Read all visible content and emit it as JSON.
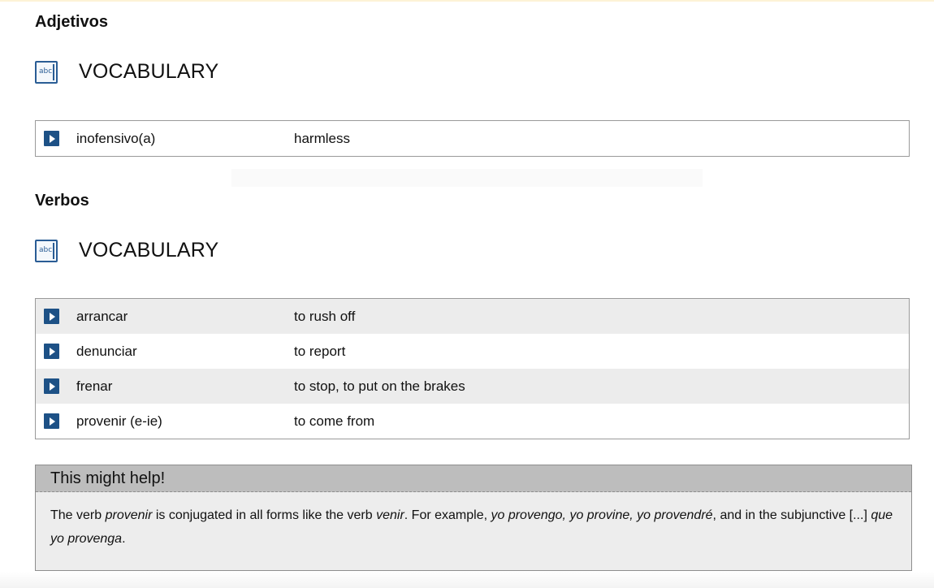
{
  "sections": [
    {
      "heading": "Adjetivos",
      "vocab_label": "VOCABULARY",
      "icon_text": "abc",
      "rows": [
        {
          "term": "inofensivo(a)",
          "meaning": "harmless"
        }
      ]
    },
    {
      "heading": "Verbos",
      "vocab_label": "VOCABULARY",
      "icon_text": "abc",
      "rows": [
        {
          "term": "arrancar",
          "meaning": "to rush off"
        },
        {
          "term": "denunciar",
          "meaning": "to report"
        },
        {
          "term": "frenar",
          "meaning": "to stop, to put on the brakes"
        },
        {
          "term": "provenir (e-ie)",
          "meaning": "to come from"
        }
      ]
    }
  ],
  "help": {
    "title": "This might help!",
    "t1": "The verb ",
    "i1": "provenir",
    "t2": " is conjugated in all forms like the verb ",
    "i2": "venir",
    "t3": ". For example, ",
    "i3": "yo provengo, yo provine, yo provendré",
    "t4": ", and in the subjunctive [...] ",
    "i4": "que yo provenga",
    "t5": "."
  },
  "colors": {
    "play_button": "#1d5186",
    "icon_accent": "#2a5d95",
    "row_shade": "#ececec",
    "help_header": "#bdbdbd",
    "help_body": "#ededed"
  },
  "icons": {
    "audio_play": "play-icon",
    "vocabulary": "abc-book-icon"
  }
}
